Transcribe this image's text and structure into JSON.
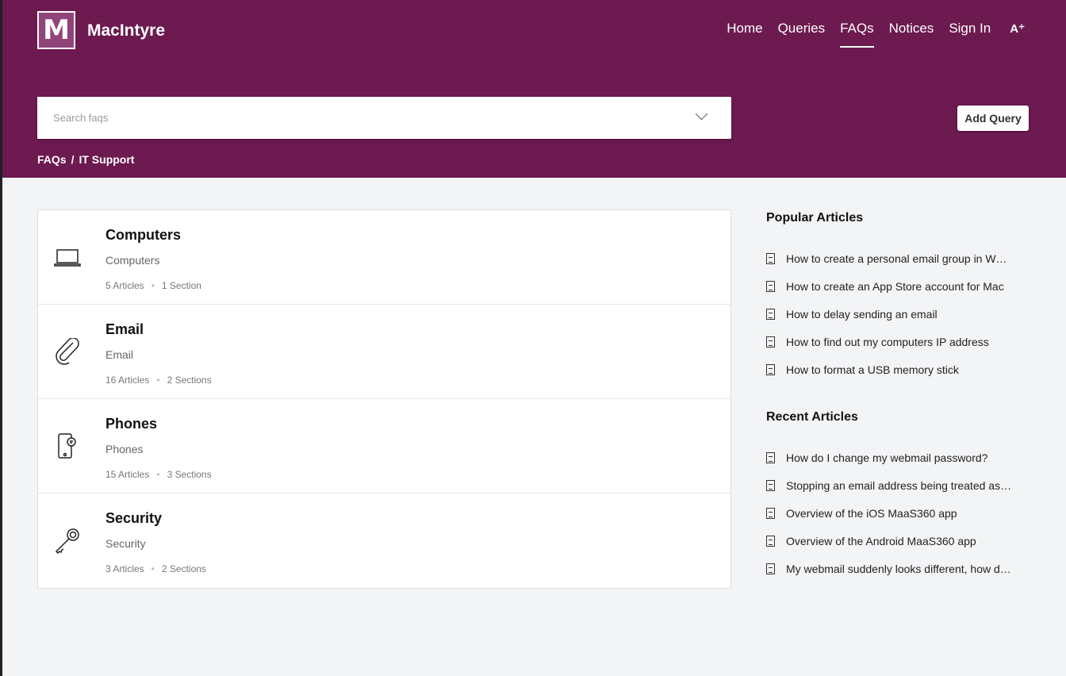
{
  "header": {
    "logo_letter": "M",
    "brand": "MacIntyre",
    "nav": [
      "Home",
      "Queries",
      "FAQs",
      "Notices",
      "Sign In"
    ],
    "font_size_button": "A⁺",
    "active_nav": "FAQs"
  },
  "search": {
    "placeholder": "Search faqs",
    "value": ""
  },
  "add_query": "Add Query",
  "breadcrumb": [
    "FAQs",
    "/",
    "IT Support"
  ],
  "categories": [
    {
      "title": "Computers",
      "desc": "Computers",
      "articles": "5 Articles",
      "sections": "1 Section",
      "icon": "laptop-icon"
    },
    {
      "title": "Email",
      "desc": "Email",
      "articles": "16 Articles",
      "sections": "2 Sections",
      "icon": "paperclip-icon"
    },
    {
      "title": "Phones",
      "desc": "Phones",
      "articles": "15 Articles",
      "sections": "3 Sections",
      "icon": "phone-icon"
    },
    {
      "title": "Security",
      "desc": "Security",
      "articles": "3 Articles",
      "sections": "2 Sections",
      "icon": "key-icon"
    }
  ],
  "popular": {
    "title": "Popular Articles",
    "items": [
      "How to create a personal email group in Webmail",
      "How to create an App Store account for Mac",
      "How to delay sending an email",
      "How to find out my computers IP address",
      "How to format a USB memory stick"
    ]
  },
  "recent": {
    "title": "Recent Articles",
    "items": [
      "How do I change my webmail password?",
      "Stopping an email address being treated as Junk",
      "Overview of the iOS MaaS360 app",
      "Overview of the Android MaaS360 app",
      "My webmail suddenly looks different, how do I change it back?"
    ]
  }
}
